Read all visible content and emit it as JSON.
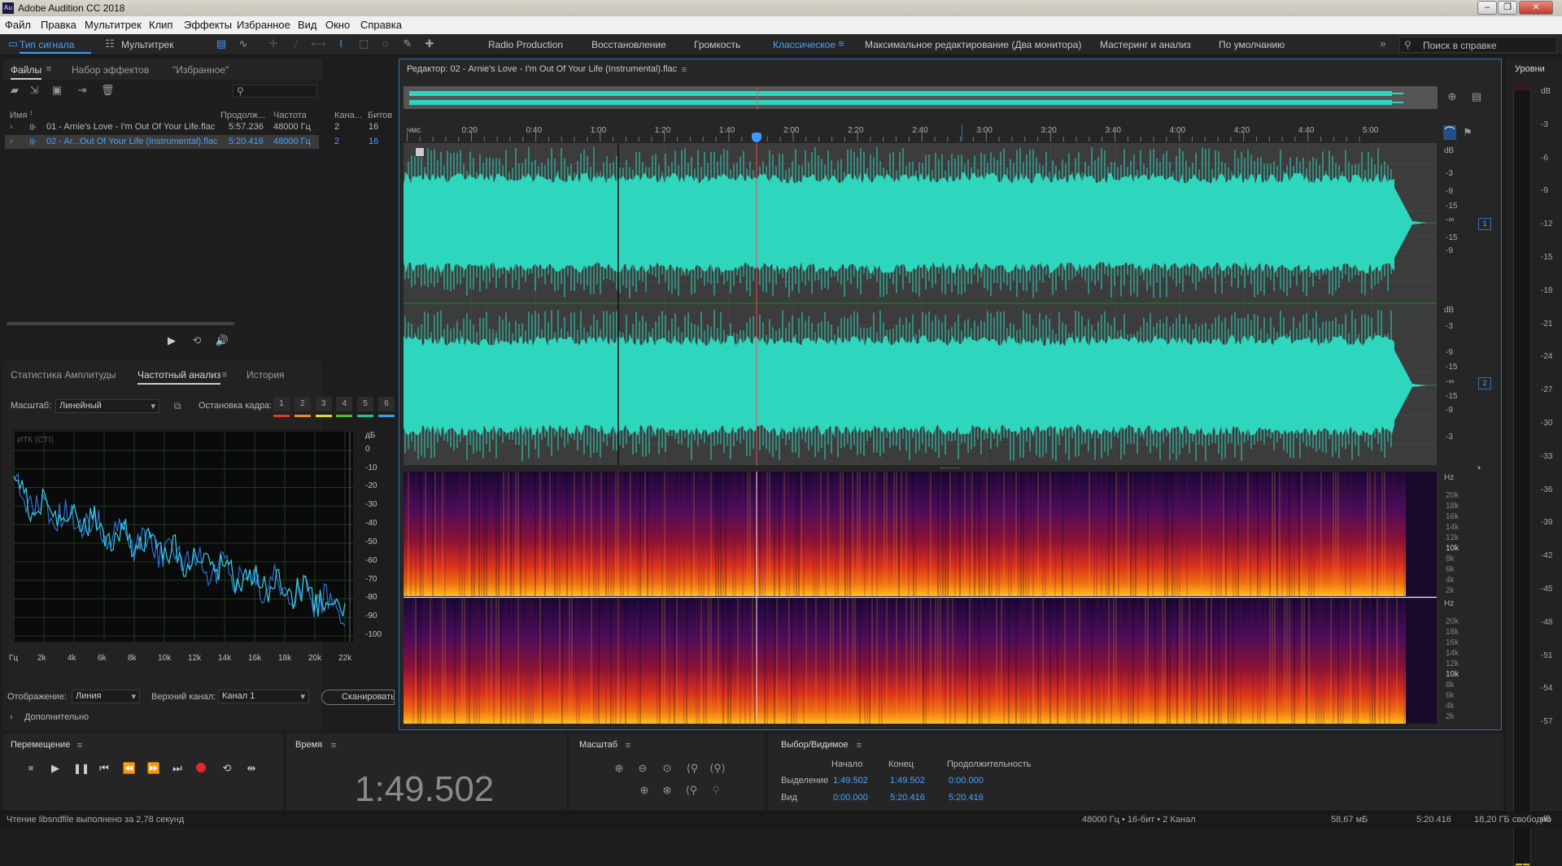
{
  "window": {
    "title": "Adobe Audition CC 2018",
    "icon": "Au"
  },
  "menu": [
    "Файл",
    "Правка",
    "Мультитрек",
    "Клип",
    "Эффекты",
    "Избранное",
    "Вид",
    "Окно",
    "Справка"
  ],
  "toolbar": {
    "waveform_btn": "Тип сигнала",
    "multitrack_btn": "Мультитрек",
    "workspaces": [
      "Radio Production",
      "Восстановление",
      "Громкость",
      "Классическое",
      "Максимальное редактирование (Два монитора)",
      "Мастеринг и анализ",
      "По умолчанию"
    ],
    "active_workspace": "Классическое",
    "search_placeholder": "Поиск в справке"
  },
  "files": {
    "tabs": [
      "Файлы",
      "Набор эффектов",
      "\"Избранное\""
    ],
    "columns": [
      "Имя",
      "Продолж...",
      "Частота",
      "Кана...",
      "Битов"
    ],
    "rows": [
      {
        "name": "01 - Arnie's Love - I'm Out Of Your Life.flac",
        "duration": "5:57.236",
        "rate": "48000 Гц",
        "channels": "2",
        "bits": "16"
      },
      {
        "name": "02 - Ar...Out Of Your Life (Instrumental).flac",
        "duration": "5:20.416",
        "rate": "48000 Гц",
        "channels": "2",
        "bits": "16"
      }
    ]
  },
  "analysis": {
    "tabs": [
      "Статистика Амплитуды",
      "Частотный анализ",
      "История"
    ],
    "scale_label": "Масштаб:",
    "scale_value": "Линейный",
    "freeze_label": "Остановка кадра:",
    "freeze_buttons": [
      "1",
      "2",
      "3",
      "4",
      "5",
      "6"
    ],
    "freeze_colors": [
      "#e03a2c",
      "#f08a2a",
      "#e8d82a",
      "#5ab82e",
      "#2cc0a0",
      "#3aa0e0"
    ],
    "plot_label": "ИТК (CTI)",
    "db_unit": "дБ",
    "db_ticks": [
      "0",
      "-10",
      "-20",
      "-30",
      "-40",
      "-50",
      "-60",
      "-70",
      "-80",
      "-90",
      "-100"
    ],
    "freq_ticks": [
      "Гц",
      "2k",
      "4k",
      "6k",
      "8k",
      "10k",
      "12k",
      "14k",
      "16k",
      "18k",
      "20k",
      "22k"
    ],
    "display_label": "Отображение:",
    "display_value": "Линия",
    "top_channel_label": "Верхний канал:",
    "top_channel_value": "Канал 1",
    "scan_button": "Сканировать",
    "advanced": "Дополнительно"
  },
  "editor": {
    "title": "Редактор: 02 - Arnie's Love - I'm Out Of Your Life (Instrumental).flac",
    "ruler_unit": "чмс",
    "ruler": [
      "0:20",
      "0:40",
      "1:00",
      "1:20",
      "1:40",
      "2:00",
      "2:20",
      "2:40",
      "3:00",
      "3:20",
      "3:40",
      "4:00",
      "4:20",
      "4:40",
      "5:00"
    ],
    "db_unit": "dB",
    "db_ticks_ch": [
      "-3",
      "-9",
      "-15",
      "-∞",
      "-15",
      "-9"
    ],
    "db_ticks_ch2": [
      "-3",
      "-9",
      "-15",
      "-∞",
      "-15",
      "-9",
      "-3"
    ],
    "channel_badges": [
      "1",
      "2"
    ],
    "hz_unit": "Hz",
    "hz_ticks": [
      "20k",
      "18k",
      "16k",
      "14k",
      "12k",
      "10k",
      "8k",
      "6k",
      "4k",
      "2k"
    ],
    "playhead_time_fraction": 0.342,
    "waveform_color": "#2ed6be"
  },
  "levels": {
    "title": "Уровни",
    "db_ticks": [
      "dB",
      "-3",
      "-6",
      "-9",
      "-12",
      "-15",
      "-18",
      "-21",
      "-24",
      "-27",
      "-30",
      "-33",
      "-36",
      "-39",
      "-42",
      "-45",
      "-48",
      "-51",
      "-54",
      "-57",
      "dB"
    ]
  },
  "transport": {
    "title": "Перемещение"
  },
  "time": {
    "title": "Время",
    "value": "1:49.502"
  },
  "zoom": {
    "title": "Масштаб"
  },
  "selection": {
    "title": "Выбор/Видимое",
    "col_start": "Начало",
    "col_end": "Конец",
    "col_duration": "Продолжительность",
    "sel_label": "Выделение",
    "sel_start": "1:49.502",
    "sel_end": "1:49.502",
    "sel_duration": "0:00.000",
    "view_label": "Вид",
    "view_start": "0:00.000",
    "view_end": "5:20.416",
    "view_duration": "5:20.416"
  },
  "status": {
    "left": "Чтение libsndfile выполнено за 2,78 секунд",
    "format": "48000 Гц • 16-бит • 2 Канал",
    "size": "58,67 мБ",
    "duration": "5:20.416",
    "free": "18,20 ГБ свободно"
  }
}
